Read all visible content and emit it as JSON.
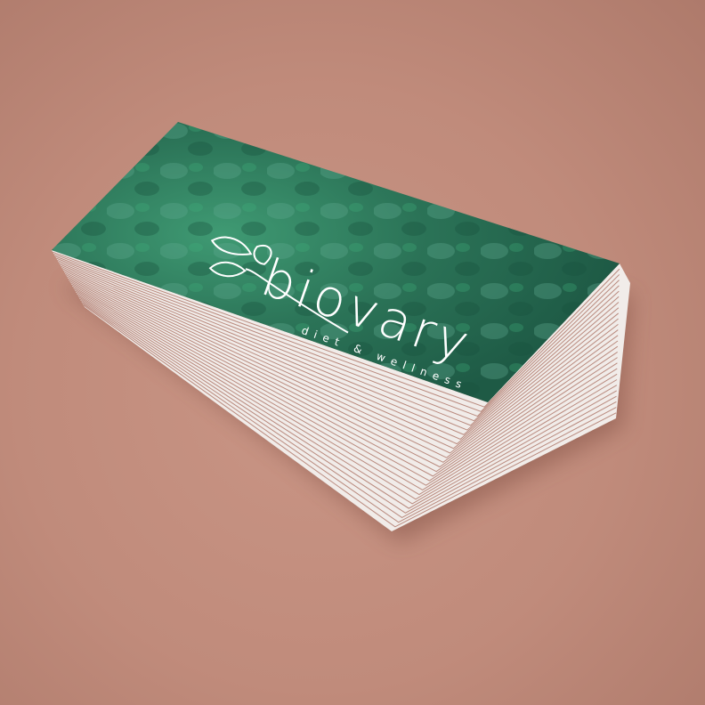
{
  "brand": {
    "name": "biovary",
    "tagline": "diet & wellness"
  },
  "colors": {
    "background": "#c4907f",
    "card_green": "#2f7a5e",
    "card_edge": "#efebe8"
  }
}
